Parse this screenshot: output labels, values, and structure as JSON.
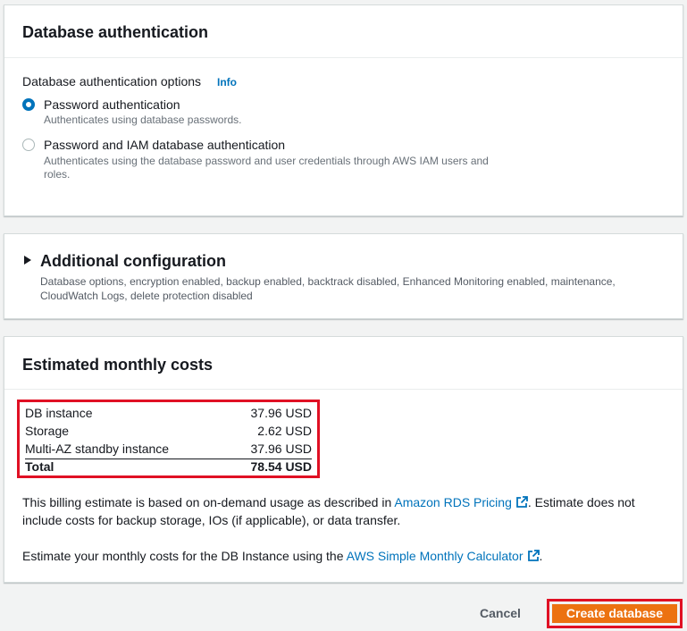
{
  "auth": {
    "title": "Database authentication",
    "options_label": "Database authentication options",
    "info_link": "Info",
    "options": [
      {
        "label": "Password authentication",
        "description": "Authenticates using database passwords.",
        "selected": true
      },
      {
        "label": "Password and IAM database authentication",
        "description": "Authenticates using the database password and user credentials through AWS IAM users and roles.",
        "selected": false
      }
    ]
  },
  "additional": {
    "title": "Additional configuration",
    "description": "Database options, encryption enabled, backup enabled, backtrack disabled, Enhanced Monitoring enabled, maintenance, CloudWatch Logs, delete protection disabled"
  },
  "costs": {
    "title": "Estimated monthly costs",
    "rows": [
      {
        "label": "DB instance",
        "value": "37.96 USD"
      },
      {
        "label": "Storage",
        "value": "2.62 USD"
      },
      {
        "label": "Multi-AZ standby instance",
        "value": "37.96 USD"
      }
    ],
    "total": {
      "label": "Total",
      "value": "78.54 USD"
    },
    "billing_note_before": "This billing estimate is based on on-demand usage as described in ",
    "billing_link": "Amazon RDS Pricing",
    "billing_note_after": ". Estimate does not include costs for backup storage, IOs (if applicable), or data transfer.",
    "calc_note_before": "Estimate your monthly costs for the DB Instance using the ",
    "calc_link": "AWS Simple Monthly Calculator",
    "calc_note_after": "."
  },
  "footer": {
    "cancel_label": "Cancel",
    "create_label": "Create database"
  },
  "colors": {
    "accent": "#0073bb",
    "primary_button": "#ec7211",
    "highlight": "#e01024"
  },
  "icons": {
    "external": "external-link-icon",
    "expand": "caret-right-icon"
  }
}
